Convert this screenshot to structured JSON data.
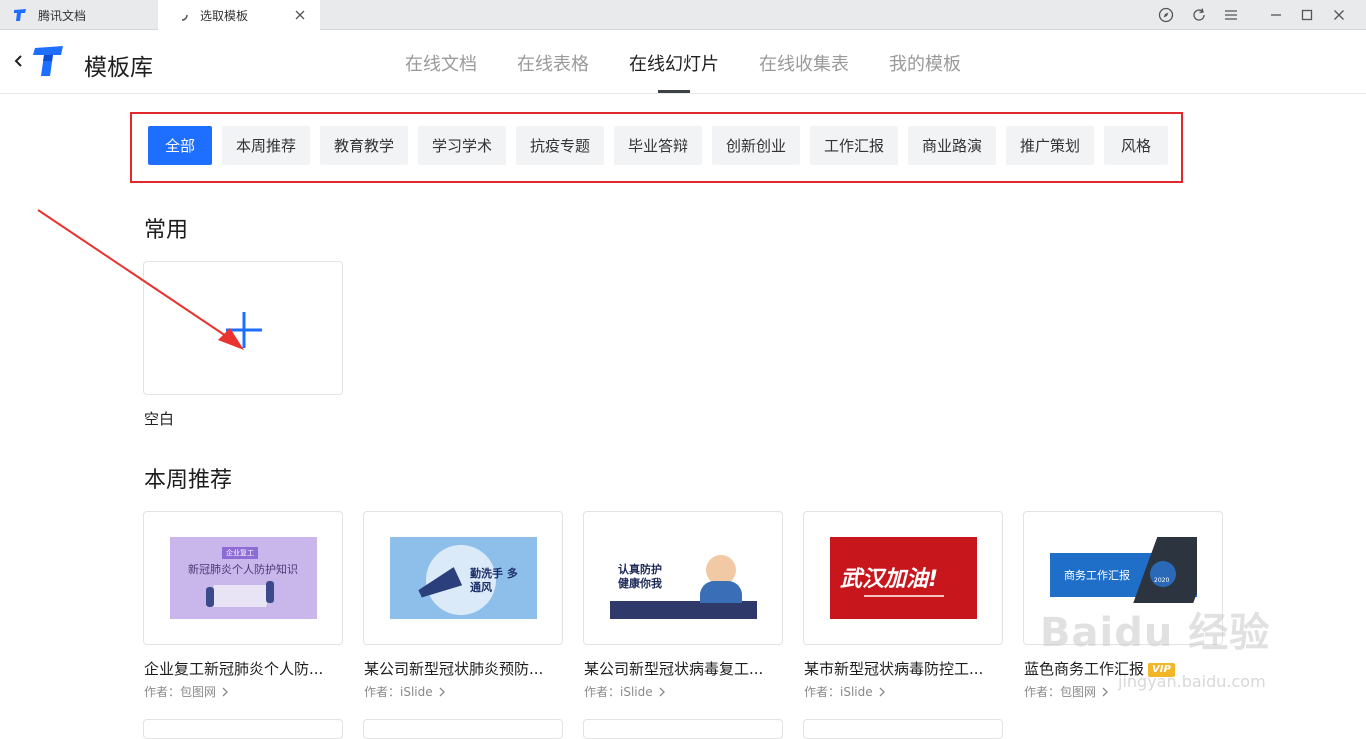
{
  "browser": {
    "tabs": [
      {
        "label": "腾讯文档"
      },
      {
        "label": "选取模板"
      }
    ]
  },
  "header": {
    "title": "模板库",
    "nav": [
      "在线文档",
      "在线表格",
      "在线幻灯片",
      "在线收集表",
      "我的模板"
    ],
    "active_nav": "在线幻灯片"
  },
  "categories": [
    "全部",
    "本周推荐",
    "教育教学",
    "学习学术",
    "抗疫专题",
    "毕业答辩",
    "创新创业",
    "工作汇报",
    "商业路演",
    "推广策划",
    "风格"
  ],
  "sections": {
    "common_title": "常用",
    "blank_label": "空白",
    "weekly_title": "本周推荐"
  },
  "templates": [
    {
      "name": "企业复工新冠肺炎个人防...",
      "author": "作者：包图网",
      "vip": "",
      "thumb": {
        "tag": "企业复工",
        "headline": "新冠肺炎个人防护知识"
      }
    },
    {
      "name": "某公司新型冠状肺炎预防...",
      "author": "作者：iSlide",
      "vip": "",
      "thumb": {
        "headline": "勤洗手 多通风"
      }
    },
    {
      "name": "某公司新型冠状病毒复工...",
      "author": "作者：iSlide",
      "vip": "",
      "thumb": {
        "headline": "认真防护 健康你我"
      }
    },
    {
      "name": "某市新型冠状病毒防控工...",
      "author": "作者：iSlide",
      "vip": "",
      "thumb": {
        "headline": "武汉加油!"
      }
    },
    {
      "name": "蓝色商务工作汇报",
      "author": "作者：包图网",
      "vip": "VIP",
      "thumb": {
        "headline": "商务工作汇报",
        "year": "2020"
      }
    }
  ],
  "watermark": {
    "brand": "Baidu 经验",
    "url": "jingyan.baidu.com"
  },
  "colors": {
    "accent": "#1e6fff",
    "highlight_box": "#e0282d",
    "annotation_arrow": "#e8332f"
  }
}
